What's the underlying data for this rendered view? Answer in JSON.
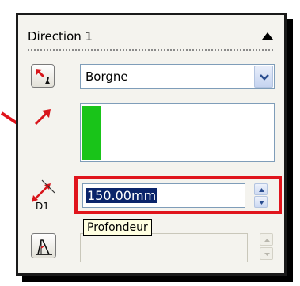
{
  "section": {
    "title": "Direction 1",
    "collapse_icon": "caret-up-icon"
  },
  "end_condition": {
    "icon": "reverse-direction-icon",
    "selected": "Borgne",
    "dropdown_icon": "chevron-down-icon"
  },
  "direction_vector": {
    "icon": "direction-arrow-icon",
    "selection_color": "#19c419"
  },
  "depth": {
    "icon": "depth-D1-icon",
    "icon_label": "D1",
    "value": "150.00mm",
    "tooltip": "Profondeur",
    "highlight_color": "#e0141c"
  },
  "draft": {
    "icon": "draft-icon"
  },
  "callout": {
    "color": "#e0141c"
  }
}
